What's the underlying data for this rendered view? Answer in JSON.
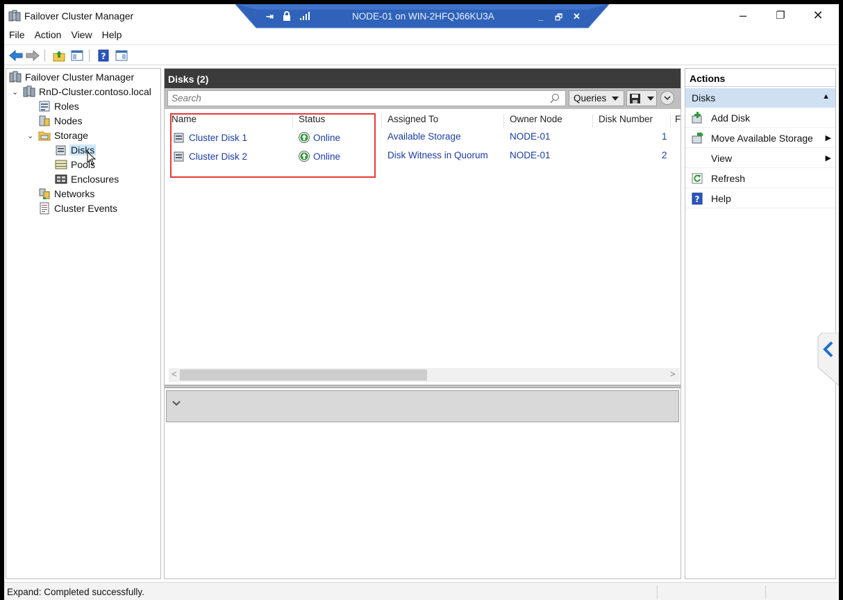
{
  "window": {
    "title": "Failover Cluster Manager",
    "controls": {
      "minimize": "–",
      "restore": "❐",
      "close": "✕"
    }
  },
  "rdp_bar": {
    "title": "NODE-01 on WIN-2HFQJ66KU3A",
    "pin_icon": "pin-icon",
    "lock_icon": "lock-icon",
    "signal_icon": "signal-icon",
    "controls": {
      "minimize": "_",
      "restore": "🗗",
      "close": "✕"
    }
  },
  "menu": [
    "File",
    "Action",
    "View",
    "Help"
  ],
  "tree": {
    "items": [
      {
        "label": "Failover Cluster Manager",
        "icon": "cluster-manager-icon"
      },
      {
        "label": "RnD-Cluster.contoso.local",
        "icon": "cluster-icon"
      },
      {
        "label": "Roles",
        "icon": "roles-icon"
      },
      {
        "label": "Nodes",
        "icon": "nodes-icon"
      },
      {
        "label": "Storage",
        "icon": "storage-folder-icon"
      },
      {
        "label": "Disks",
        "icon": "disks-icon"
      },
      {
        "label": "Pools",
        "icon": "pools-icon"
      },
      {
        "label": "Enclosures",
        "icon": "enclosures-icon"
      },
      {
        "label": "Networks",
        "icon": "networks-icon"
      },
      {
        "label": "Cluster Events",
        "icon": "cluster-events-icon"
      }
    ]
  },
  "center": {
    "header": "Disks (2)",
    "search_placeholder": "Search",
    "queries_label": "Queries",
    "columns": [
      "Name",
      "Status",
      "Assigned To",
      "Owner Node",
      "Disk Number",
      "F"
    ],
    "rows": [
      {
        "name": "Cluster Disk 1",
        "status": "Online",
        "assigned_to": "Available Storage",
        "owner_node": "NODE-01",
        "disk_number": "1"
      },
      {
        "name": "Cluster Disk 2",
        "status": "Online",
        "assigned_to": "Disk Witness in Quorum",
        "owner_node": "NODE-01",
        "disk_number": "2"
      }
    ]
  },
  "actions": {
    "header": "Actions",
    "section": "Disks",
    "items": [
      {
        "label": "Add Disk",
        "icon": "add-disk-icon"
      },
      {
        "label": "Move Available Storage",
        "icon": "move-storage-icon",
        "submenu": true
      },
      {
        "label": "View",
        "icon": "",
        "submenu": true
      },
      {
        "label": "Refresh",
        "icon": "refresh-icon"
      },
      {
        "label": "Help",
        "icon": "help-icon"
      }
    ]
  },
  "status_bar": {
    "text": "Expand:  Completed successfully."
  },
  "colors": {
    "header_bg": "#3b3b3b",
    "link_blue": "#1a3ca8",
    "selection": "#cce8ff",
    "actions_section_bg": "#cfe0f3",
    "highlight_red": "#e53838",
    "status_green": "#2e9a3a",
    "rdp_bar_blue": "#2f62b8"
  }
}
